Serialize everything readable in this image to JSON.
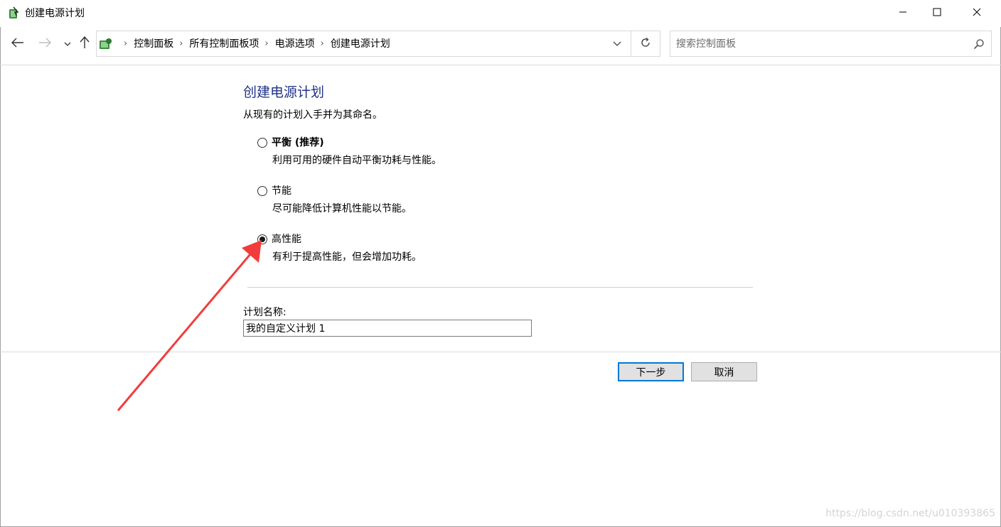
{
  "window": {
    "title": "创建电源计划",
    "controls": [
      "minimize",
      "maximize",
      "close"
    ]
  },
  "nav": {
    "back_icon": "arrow-left-icon",
    "forward_icon": "arrow-right-icon",
    "recent_icon": "chevron-down-icon",
    "up_icon": "arrow-up-icon"
  },
  "breadcrumb": [
    "控制面板",
    "所有控制面板项",
    "电源选项",
    "创建电源计划"
  ],
  "search": {
    "placeholder": "搜索控制面板",
    "value": ""
  },
  "main": {
    "title": "创建电源计划",
    "instruction": "从现有的计划入手并为其命名。",
    "options": [
      {
        "label": "平衡 (推荐)",
        "description": "利用可用的硬件自动平衡功耗与性能。",
        "selected": false,
        "bold": true
      },
      {
        "label": "节能",
        "description": "尽可能降低计算机性能以节能。",
        "selected": false,
        "bold": false
      },
      {
        "label": "高性能",
        "description": "有利于提高性能，但会增加功耗。",
        "selected": true,
        "bold": false
      }
    ],
    "plan_name_label": "计划名称:",
    "plan_name_value": "我的自定义计划 1"
  },
  "buttons": {
    "next": "下一步",
    "cancel": "取消"
  },
  "watermark": "https://blog.csdn.net/u010393865",
  "colors": {
    "title_blue": "#1e3287",
    "annotation_arrow": "#f23c3c",
    "focus_border": "#0078d7"
  }
}
